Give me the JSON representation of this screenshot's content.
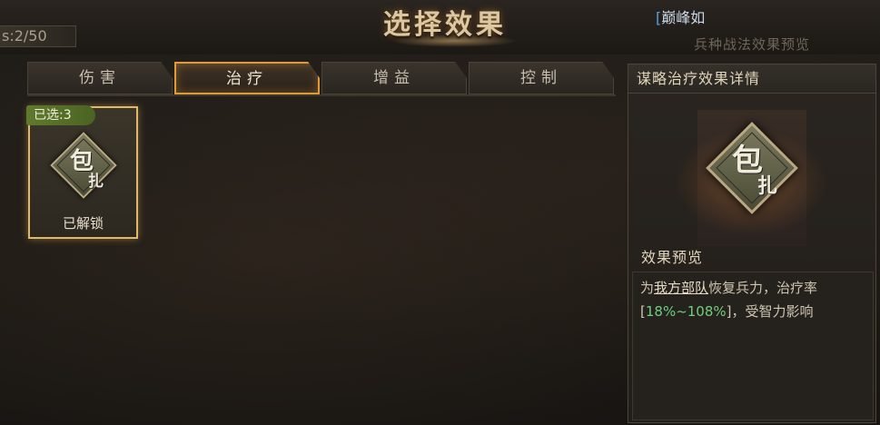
{
  "header": {
    "title": "选择效果",
    "selected_count": "s:2/50",
    "user_tag_open": "[",
    "user_tag_name": "巅峰如",
    "preview_link": "兵种战法效果预览"
  },
  "tabs": [
    {
      "label": "伤害",
      "active": false
    },
    {
      "label": "治疗",
      "active": true
    },
    {
      "label": "增益",
      "active": false
    },
    {
      "label": "控制",
      "active": false
    }
  ],
  "cards": [
    {
      "badge": "已选:3",
      "glyph_main": "包",
      "glyph_sub": "扎",
      "status": "已解锁"
    }
  ],
  "detail_panel": {
    "title": "谋略治疗效果详情",
    "glyph_main": "包",
    "glyph_sub": "扎",
    "preview_heading": "效果预览",
    "desc_part1": "为",
    "desc_target": "我方部队",
    "desc_part2": "恢复兵力，治疗率[",
    "desc_rate": "18%~108%",
    "desc_part3": "]，受智力影响"
  },
  "colors": {
    "accent": "#e09a3a",
    "card_border": "#e2b866",
    "badge_green": "#5f7a2c",
    "rate_green": "#6fcf7f",
    "user_blue": "#4fa4e8"
  }
}
